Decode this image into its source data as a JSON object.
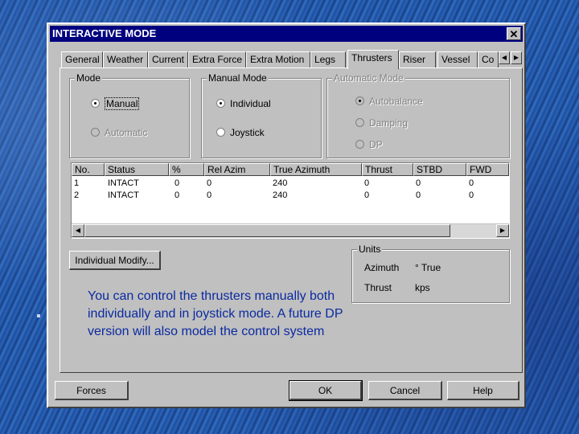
{
  "window": {
    "title": "INTERACTIVE MODE",
    "close_label": "✕"
  },
  "tabs": [
    {
      "label": "General"
    },
    {
      "label": "Weather"
    },
    {
      "label": "Current"
    },
    {
      "label": "Extra Force"
    },
    {
      "label": "Extra Motion"
    },
    {
      "label": "Legs"
    },
    {
      "label": "Thrusters",
      "active": true
    },
    {
      "label": "Riser"
    },
    {
      "label": "Vessel"
    },
    {
      "label": "Co"
    }
  ],
  "tab_scroll": {
    "left_icon": "◀",
    "right_icon": "▶"
  },
  "mode_group": {
    "title": "Mode",
    "options": [
      {
        "label": "Manual",
        "selected": true
      },
      {
        "label": "Automatic",
        "selected": false,
        "disabled": true
      }
    ]
  },
  "manual_mode_group": {
    "title": "Manual Mode",
    "options": [
      {
        "label": "Individual",
        "selected": true
      },
      {
        "label": "Joystick",
        "selected": false
      }
    ]
  },
  "automatic_mode_group": {
    "title": "Automatic Mode",
    "options": [
      {
        "label": "Autobalance",
        "selected": true,
        "disabled": true
      },
      {
        "label": "Damping",
        "selected": false,
        "disabled": true
      },
      {
        "label": "DP",
        "selected": false,
        "disabled": true
      }
    ]
  },
  "thruster_table": {
    "columns": [
      "No.",
      "Status",
      "%",
      "Rel Azim",
      "True Azimuth",
      "Thrust",
      "STBD",
      "FWD"
    ],
    "rows": [
      [
        "1",
        "INTACT",
        "0",
        "0",
        "240",
        "0",
        "0",
        "0"
      ],
      [
        "2",
        "INTACT",
        "0",
        "0",
        "240",
        "0",
        "0",
        "0"
      ]
    ]
  },
  "scrollbar": {
    "left_icon": "◀",
    "right_icon": "▶"
  },
  "individual_modify_button": "Individual Modify...",
  "units_group": {
    "title": "Units",
    "rows": [
      {
        "label": "Azimuth",
        "value": "° True"
      },
      {
        "label": "Thrust",
        "value": "kps"
      }
    ]
  },
  "info_text": "You can control the thrusters manually both individually and in joystick mode. A future DP version will also model the control system",
  "footer": {
    "forces_label": "Forces",
    "ok_label": "OK",
    "cancel_label": "Cancel",
    "help_label": "Help"
  }
}
